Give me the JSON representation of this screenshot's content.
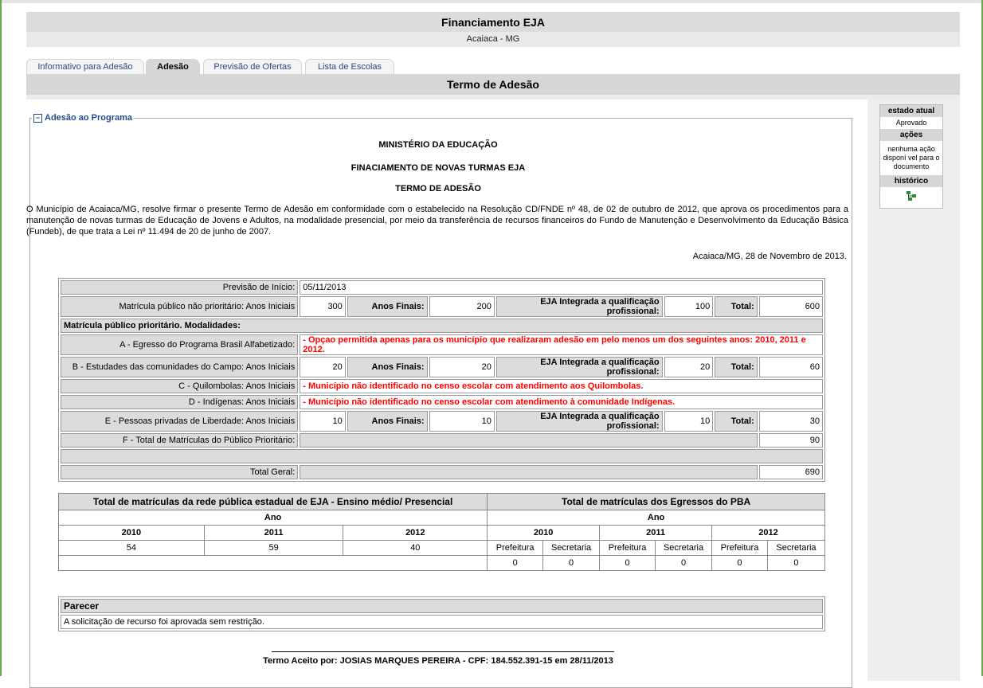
{
  "header": {
    "title": "Financiamento EJA",
    "subtitle": "Acaiaca - MG"
  },
  "tabs": [
    {
      "label": "Informativo para Adesão",
      "active": false
    },
    {
      "label": "Adesão",
      "active": true
    },
    {
      "label": "Previsão de Ofertas",
      "active": false
    },
    {
      "label": "Lista de Escolas",
      "active": false
    }
  ],
  "section_title": "Termo de Adesão",
  "fieldset_legend": "Adesão ao Programa",
  "doc": {
    "ministerio": "MINISTÉRIO DA EDUCAÇÃO",
    "financiamento": "FINACIAMENTO DE NOVAS TURMAS EJA",
    "termo": "TERMO DE ADESÃO",
    "paragraph": "O Município de Acaiaca/MG, resolve firmar o presente Termo de Adesão em conformidade com o estabelecido na Resolução CD/FNDE nº 48, de 02 de outubro de 2012, que aprova os procedimentos para a manutenção de novas turmas de Educação de Jovens e Adultos, na modalidade presencial, por meio da transferência de recursos financeiros do Fundo de Manutenção e Desenvolvimento da Educação Básica (Fundeb), de que trata a Lei nº 11.494 de 20 de junho de 2007.",
    "date_line": "Acaiaca/MG, 28 de Novembro de 2013."
  },
  "form": {
    "previsao_label": "Previsão de Início:",
    "previsao_value": "05/11/2013",
    "nao_prio_label": "Matrícula público não prioritário: Anos Iniciais",
    "nao_prio": {
      "iniciais": "300",
      "finais": "200",
      "integrada": "100",
      "total": "600"
    },
    "anos_finais_label": "Anos Finais:",
    "integrada_label": "EJA Integrada a qualificação profissional:",
    "total_label": "Total:",
    "prio_section": "Matrícula público prioritário. Modalidades:",
    "a_label": "A - Egresso do Programa Brasil Alfabetizado:",
    "a_warn": "- Opçao permitida apenas para os município que realizaram adesão em pelo menos um dos seguintes anos: 2010, 2011 e 2012.",
    "b_label": "B - Estudades das comunidades do Campo: Anos Iniciais",
    "b": {
      "iniciais": "20",
      "finais": "20",
      "integrada": "20",
      "total": "60"
    },
    "c_label": "C - Quilombolas: Anos Iniciais",
    "c_warn": "- Município não identificado no censo escolar com atendimento aos Quilombolas.",
    "d_label": "D - Indígenas: Anos Iniciais",
    "d_warn": "- Município não identificado no censo escolar com atendimento à comunidade Indígenas.",
    "e_label": "E - Pessoas privadas de Liberdade: Anos Iniciais",
    "e": {
      "iniciais": "10",
      "finais": "10",
      "integrada": "10",
      "total": "30"
    },
    "f_label": "F - Total de Matrículas do Público Prioritário:",
    "f_total": "90",
    "total_geral_label": "Total Geral:",
    "total_geral": "690"
  },
  "totais": {
    "left_header": "Total de matrículas da rede pública estadual de EJA - Ensino médio/ Presencial",
    "right_header": "Total de matrículas dos Egressos do PBA",
    "ano": "Ano",
    "years": [
      "2010",
      "2011",
      "2012"
    ],
    "left_values": [
      "54",
      "59",
      "40"
    ],
    "prefeitura": "Prefeitura",
    "secretaria": "Secretaria",
    "right_values": [
      "0",
      "0",
      "0",
      "0",
      "0",
      "0"
    ]
  },
  "parecer": {
    "header": "Parecer",
    "text": "A solicitação de recurso foi aprovada sem restrição."
  },
  "aceite": "Termo Aceito por: JOSIAS MARQUES PEREIRA - CPF: 184.552.391-15 em 28/11/2013",
  "sidebar": {
    "estado_header": "estado atual",
    "estado_value": "Aprovado",
    "acoes_header": "ações",
    "acoes_value": "nenhuma ação disponí vel para o documento",
    "historico_header": "histórico",
    "historico_icon": "history-tree-icon"
  }
}
